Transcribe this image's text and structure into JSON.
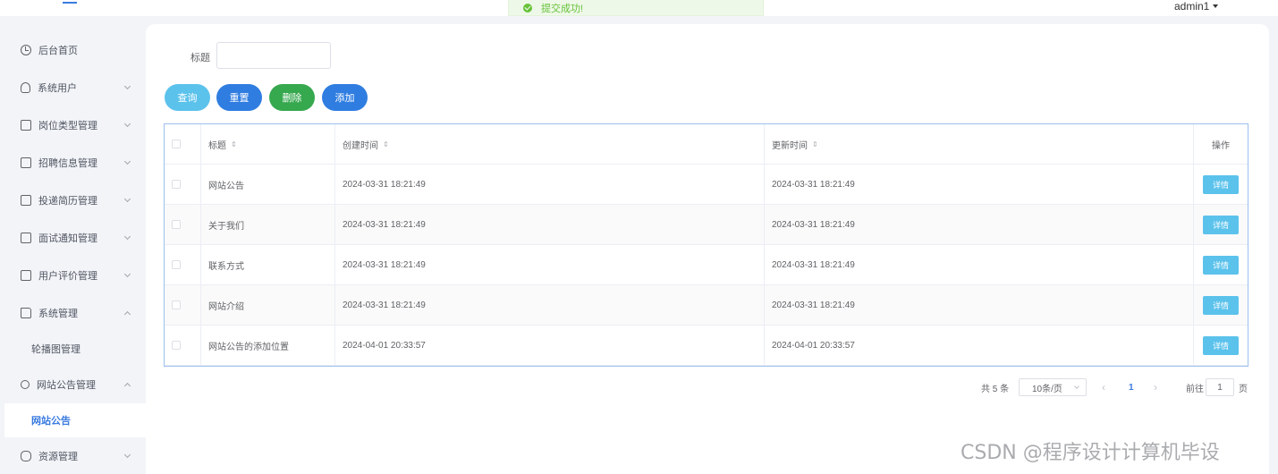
{
  "topbar": {
    "toast": "提交成功!",
    "user": "admin1"
  },
  "sidebar": {
    "items": [
      {
        "label": "后台首页",
        "icon": "clock-icon"
      },
      {
        "label": "系统用户",
        "icon": "user-icon"
      },
      {
        "label": "岗位类型管理",
        "icon": "box-icon"
      },
      {
        "label": "招聘信息管理",
        "icon": "box-icon"
      },
      {
        "label": "投递简历管理",
        "icon": "box-icon"
      },
      {
        "label": "面试通知管理",
        "icon": "box-icon"
      },
      {
        "label": "用户评价管理",
        "icon": "box-icon"
      },
      {
        "label": "系统管理",
        "icon": "folder-icon"
      },
      {
        "label": "网站公告管理",
        "icon": "search-icon"
      },
      {
        "label": "资源管理",
        "icon": "database-icon"
      }
    ],
    "sub_carousel": "轮播图管理",
    "sub_notice": "网站公告"
  },
  "filter": {
    "label": "标题",
    "value": ""
  },
  "buttons": {
    "query": "查询",
    "reset": "重置",
    "delete": "删除",
    "add": "添加"
  },
  "table": {
    "headers": [
      "标题",
      "创建时间",
      "更新时间",
      "操作"
    ],
    "rows": [
      {
        "title": "网站公告",
        "created": "2024-03-31 18:21:49",
        "updated": "2024-03-31 18:21:49",
        "action": "详情"
      },
      {
        "title": "关于我们",
        "created": "2024-03-31 18:21:49",
        "updated": "2024-03-31 18:21:49",
        "action": "详情"
      },
      {
        "title": "联系方式",
        "created": "2024-03-31 18:21:49",
        "updated": "2024-03-31 18:21:49",
        "action": "详情"
      },
      {
        "title": "网站介绍",
        "created": "2024-03-31 18:21:49",
        "updated": "2024-03-31 18:21:49",
        "action": "详情"
      },
      {
        "title": "网站公告的添加位置",
        "created": "2024-04-01 20:33:57",
        "updated": "2024-04-01 20:33:57",
        "action": "详情"
      }
    ]
  },
  "pagination": {
    "total": "共 5 条",
    "page_size": "10条/页",
    "current": "1",
    "goto": "前往",
    "jump_value": "1",
    "page_suffix": "页"
  },
  "watermark": "CSDN @程序设计计算机毕设",
  "colors": {
    "primary": "#2f7de1",
    "info": "#5bc2ec",
    "success": "#36a84e"
  }
}
